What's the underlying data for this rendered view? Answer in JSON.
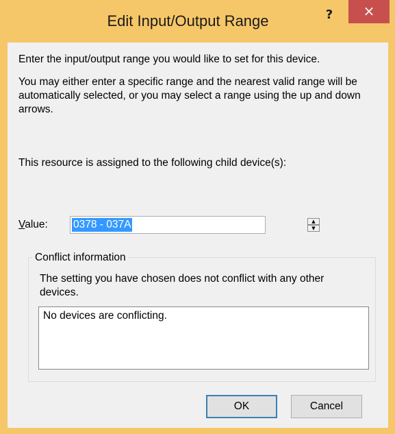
{
  "window": {
    "title": "Edit Input/Output Range",
    "help_label": "?",
    "close_label": "×"
  },
  "body": {
    "intro": "Enter the input/output range you would like to set for this device.",
    "instructions": "You may either enter a specific range and the nearest valid range will be automatically selected, or you may select a range using the up and down arrows.",
    "assigned_text": "This resource is assigned to the following child device(s):"
  },
  "value": {
    "label_mnemonic": "V",
    "label_rest": "alue:",
    "current": "0378 - 037A",
    "spin_up": "▲",
    "spin_down": "▼"
  },
  "conflict": {
    "group_title": "Conflict information",
    "message": "The setting you have chosen does not conflict with any other devices.",
    "list_text": "No devices are conflicting."
  },
  "buttons": {
    "ok": "OK",
    "cancel": "Cancel"
  },
  "colors": {
    "frame": "#f6c768",
    "close_button": "#c7504f",
    "selection": "#3399ff",
    "default_button_border": "#3c7fb1"
  }
}
